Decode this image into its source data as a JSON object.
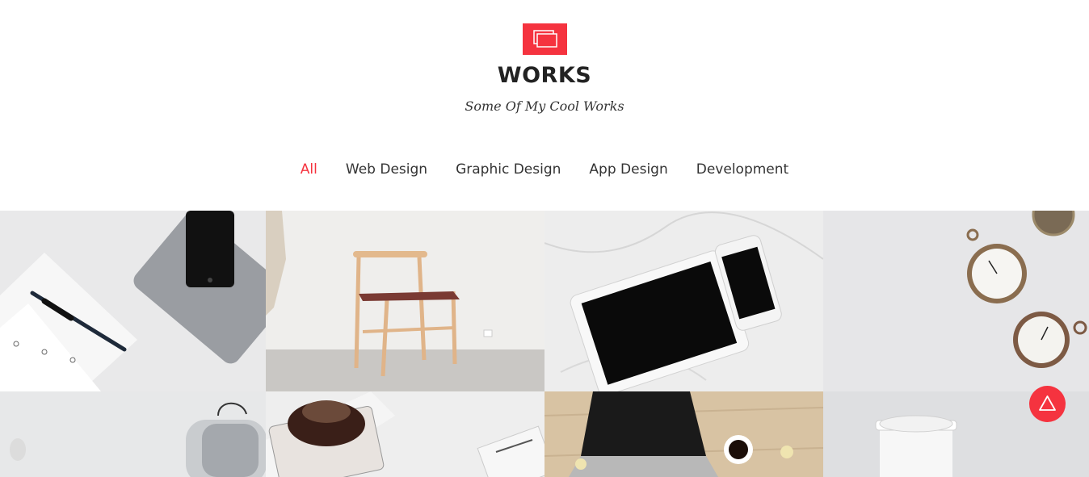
{
  "section": {
    "title": "WORKS",
    "subtitle": "Some Of My Cool Works",
    "icon": "windows-icon",
    "accent_color": "#f5333f"
  },
  "filters": [
    {
      "label": "All",
      "active": true
    },
    {
      "label": "Web Design",
      "active": false
    },
    {
      "label": "Graphic Design",
      "active": false
    },
    {
      "label": "App Design",
      "active": false
    },
    {
      "label": "Development",
      "active": false
    }
  ],
  "portfolio": [
    {
      "subject": "ipad-and-pen"
    },
    {
      "subject": "wooden-chair"
    },
    {
      "subject": "tablet-and-phone"
    },
    {
      "subject": "pocket-watches"
    },
    {
      "subject": "glass-jar"
    },
    {
      "subject": "coffee-pot"
    },
    {
      "subject": "laptop-and-coffee"
    },
    {
      "subject": "coffee-cup"
    }
  ],
  "scroll_top": {
    "icon": "triangle-up-icon"
  }
}
